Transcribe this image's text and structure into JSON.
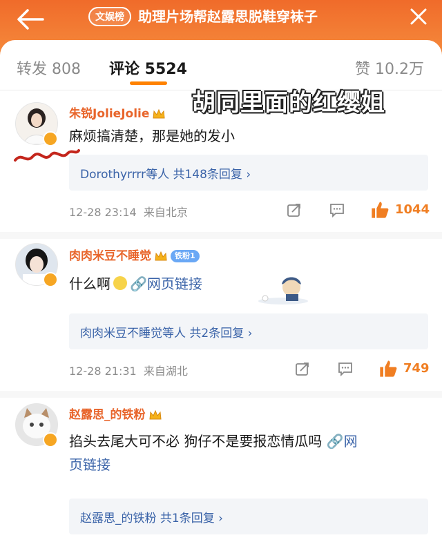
{
  "header": {
    "badge": "文娱榜",
    "title": "助理片场帮赵露思脱鞋穿袜子"
  },
  "tabs": [
    {
      "label": "转发 808"
    },
    {
      "label": "评论 5524"
    },
    {
      "label": "赞 10.2万"
    }
  ],
  "overlay": "胡同里面的红缨姐",
  "comments": [
    {
      "user": "朱锐JolieJolie",
      "text": "麻烦搞清楚，那是她的发小",
      "reply_user": "Dorothyrrrr等人",
      "reply_count": "共148条回复",
      "time": "12-28 23:14",
      "location": "来自北京",
      "likes": "1044"
    },
    {
      "user": "肉肉米豆不睡觉",
      "fan_tag": "铁粉1",
      "text": "什么啊",
      "link": "网页链接",
      "reply_user": "肉肉米豆不睡觉等人",
      "reply_count": "共2条回复",
      "time": "12-28 21:31",
      "location": "来自湖北",
      "likes": "749"
    },
    {
      "user": "赵露思_的铁粉",
      "text": "掐头去尾大可不必 狗仔不是要报恋情瓜吗",
      "link_a": "网",
      "link_b": "页链接",
      "reply_user": "赵露思_的铁粉",
      "reply_count": "共1条回复"
    }
  ],
  "colors": {
    "header": "#f06b2a",
    "username": "#e8652b",
    "link": "#3a63a8",
    "like": "#f07e22"
  }
}
